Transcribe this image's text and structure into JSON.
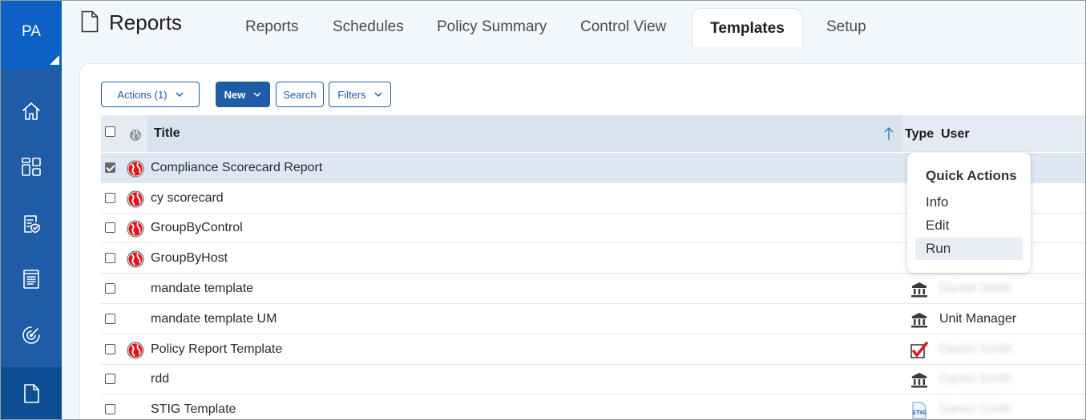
{
  "sidebar": {
    "app_label": "PA",
    "items": [
      {
        "name": "home",
        "icon": "home-icon"
      },
      {
        "name": "dashboard",
        "icon": "dashboard-icon"
      },
      {
        "name": "policy",
        "icon": "policy-shield-icon"
      },
      {
        "name": "document",
        "icon": "document-list-icon"
      },
      {
        "name": "scan",
        "icon": "radar-icon"
      },
      {
        "name": "reports",
        "icon": "page-icon",
        "active": true
      }
    ]
  },
  "header": {
    "title": "Reports",
    "tabs": [
      {
        "label": "Reports"
      },
      {
        "label": "Schedules"
      },
      {
        "label": "Policy Summary"
      },
      {
        "label": "Control View"
      },
      {
        "label": "Templates",
        "active": true
      },
      {
        "label": "Setup"
      }
    ]
  },
  "toolbar": {
    "actions_label": "Actions (1)",
    "new_label": "New",
    "search_label": "Search",
    "filters_label": "Filters"
  },
  "table": {
    "columns": {
      "title": "Title",
      "type": "Type",
      "user": "User"
    },
    "rows": [
      {
        "title": "Compliance Scorecard Report",
        "globe": true,
        "checked": true,
        "type_icon": "",
        "user": "",
        "user_blurred": false
      },
      {
        "title": "cy scorecard",
        "globe": true,
        "checked": false,
        "type_icon": "",
        "user": "",
        "user_blurred": false
      },
      {
        "title": "GroupByControl",
        "globe": true,
        "checked": false,
        "type_icon": "",
        "user": "",
        "user_blurred": false
      },
      {
        "title": "GroupByHost",
        "globe": true,
        "checked": false,
        "type_icon": "",
        "user": "",
        "user_blurred": false
      },
      {
        "title": "mandate template",
        "globe": false,
        "checked": false,
        "type_icon": "mandate-icon",
        "user": "Daniel Smith",
        "user_blurred": true
      },
      {
        "title": "mandate template UM",
        "globe": false,
        "checked": false,
        "type_icon": "mandate-icon",
        "user": "Unit Manager",
        "user_blurred": false
      },
      {
        "title": "Policy Report Template",
        "globe": true,
        "checked": false,
        "type_icon": "policy-check-icon",
        "user": "Daniel Smith",
        "user_blurred": true
      },
      {
        "title": "rdd",
        "globe": false,
        "checked": false,
        "type_icon": "mandate-icon",
        "user": "Daniel Smith",
        "user_blurred": true
      },
      {
        "title": "STIG Template",
        "globe": false,
        "checked": false,
        "type_icon": "stig-icon",
        "user": "Daniel Smith",
        "user_blurred": true
      }
    ]
  },
  "quick_actions": {
    "title": "Quick Actions",
    "items": [
      {
        "label": "Info"
      },
      {
        "label": "Edit"
      },
      {
        "label": "Run",
        "hover": true
      }
    ]
  },
  "colors": {
    "brand": "#1f5ca8",
    "sidebar_active": "#0d4f95",
    "app_tile": "#0c62c4"
  }
}
